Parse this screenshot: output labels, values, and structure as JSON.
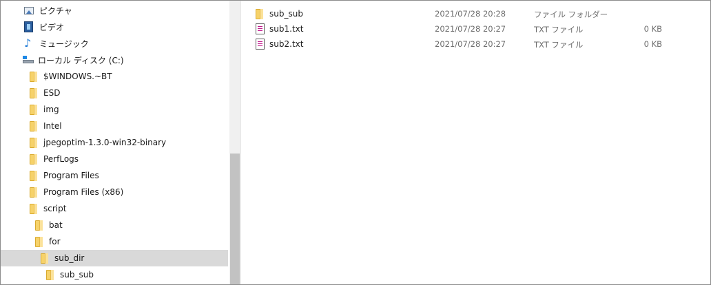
{
  "nav": {
    "items": [
      {
        "label": "ピクチャ",
        "icon": "pictures-icon"
      },
      {
        "label": "ビデオ",
        "icon": "video-icon"
      },
      {
        "label": "ミュージック",
        "icon": "music-icon"
      },
      {
        "label": "ローカル ディスク (C:)",
        "icon": "drive-icon"
      },
      {
        "label": "$WINDOWS.~BT",
        "icon": "folder-icon"
      },
      {
        "label": "ESD",
        "icon": "folder-icon"
      },
      {
        "label": "img",
        "icon": "folder-icon"
      },
      {
        "label": "Intel",
        "icon": "folder-icon"
      },
      {
        "label": "jpegoptim-1.3.0-win32-binary",
        "icon": "folder-icon"
      },
      {
        "label": "PerfLogs",
        "icon": "folder-icon"
      },
      {
        "label": "Program Files",
        "icon": "folder-icon"
      },
      {
        "label": "Program Files (x86)",
        "icon": "folder-icon"
      },
      {
        "label": "script",
        "icon": "folder-icon"
      },
      {
        "label": "bat",
        "icon": "folder-icon"
      },
      {
        "label": "for",
        "icon": "folder-icon"
      },
      {
        "label": "sub_dir",
        "icon": "folder-icon",
        "selected": true
      },
      {
        "label": "sub_sub",
        "icon": "folder-icon"
      }
    ]
  },
  "files": [
    {
      "name": "sub_sub",
      "date": "2021/07/28 20:28",
      "type": "ファイル フォルダー",
      "size": "",
      "icon": "folder-icon"
    },
    {
      "name": "sub1.txt",
      "date": "2021/07/28 20:27",
      "type": "TXT ファイル",
      "size": "0 KB",
      "icon": "txt-file-icon"
    },
    {
      "name": "sub2.txt",
      "date": "2021/07/28 20:27",
      "type": "TXT ファイル",
      "size": "0 KB",
      "icon": "txt-file-icon"
    }
  ],
  "colors": {
    "selection": "#d9d9d9",
    "folder": "#f6d26a",
    "scrollbar": "#f0f0f0",
    "scroll_thumb": "#c2c2c2"
  }
}
